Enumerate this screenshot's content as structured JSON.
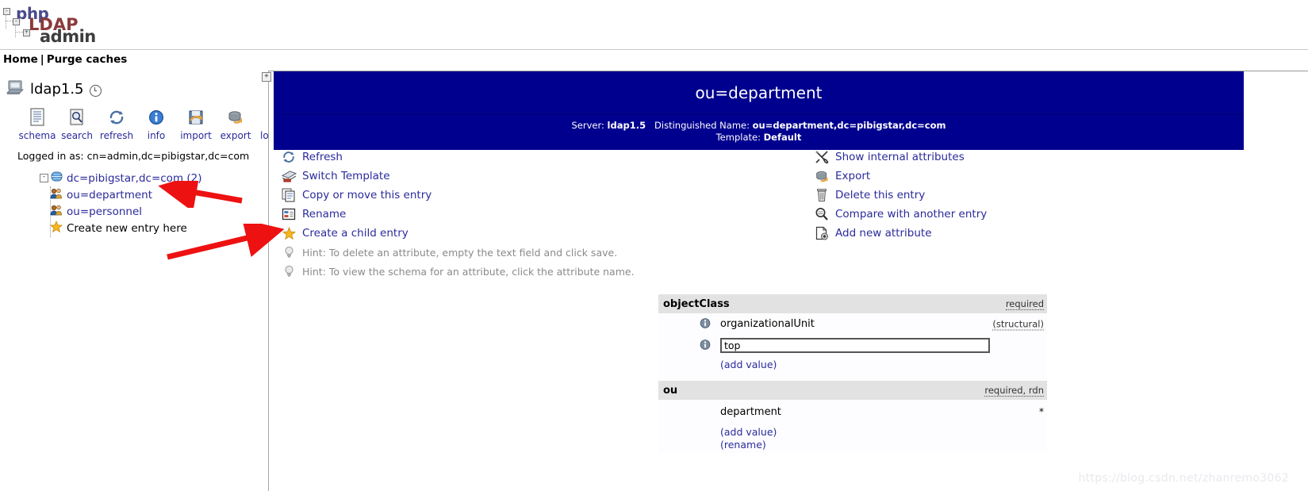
{
  "logo": {
    "php": "php",
    "ldap": "LDAP",
    "admin": "admin"
  },
  "navbar": {
    "home": "Home",
    "separator": "|",
    "purge_caches": "Purge caches"
  },
  "sidebar": {
    "server_name": "ldap1.5",
    "server_icon": "server-computer-icon",
    "clock_icon": "clock-icon",
    "toolbar": [
      {
        "label": "schema",
        "icon": "schema-document-icon"
      },
      {
        "label": "search",
        "icon": "search-magnifier-icon"
      },
      {
        "label": "refresh",
        "icon": "refresh-arrows-icon"
      },
      {
        "label": "info",
        "icon": "info-circle-icon"
      },
      {
        "label": "import",
        "icon": "import-floppy-icon"
      },
      {
        "label": "export",
        "icon": "export-disk-icon"
      },
      {
        "label": "logout",
        "icon": "logout-door-icon"
      }
    ],
    "logged_in_as": "Logged in as: cn=admin,dc=pibigstar,dc=com",
    "tree": {
      "root": {
        "label": "dc=pibigstar,dc=com (2)",
        "icon": "globe-icon",
        "expander": "-"
      },
      "children": [
        {
          "label": "ou=department",
          "icon": "ou-people-icon",
          "type": "entry"
        },
        {
          "label": "ou=personnel",
          "icon": "ou-people-icon",
          "type": "entry"
        },
        {
          "label": "Create new entry here",
          "icon": "star-icon",
          "type": "create"
        }
      ]
    }
  },
  "scroll_button": "+",
  "entry": {
    "title": "ou=department",
    "server_label": "Server:",
    "server_value": "ldap1.5",
    "dn_label": "Distinguished Name:",
    "dn_value": "ou=department,dc=pibigstar,dc=com",
    "template_label": "Template:",
    "template_value": "Default"
  },
  "actions_left": [
    {
      "label": "Refresh",
      "icon": "refresh-arrows-icon",
      "kind": "link"
    },
    {
      "label": "Switch Template",
      "icon": "switch-template-icon",
      "kind": "link"
    },
    {
      "label": "Copy or move this entry",
      "icon": "copy-icon",
      "kind": "link"
    },
    {
      "label": "Rename",
      "icon": "rename-icon",
      "kind": "link"
    },
    {
      "label": "Create a child entry",
      "icon": "star-icon",
      "kind": "link"
    },
    {
      "label": "Hint: To delete an attribute, empty the text field and click save.",
      "icon": "lightbulb-icon",
      "kind": "hint"
    },
    {
      "label": "Hint: To view the schema for an attribute, click the attribute name.",
      "icon": "lightbulb-icon",
      "kind": "hint"
    }
  ],
  "actions_right": [
    {
      "label": "Show internal attributes",
      "icon": "tools-icon"
    },
    {
      "label": "Export",
      "icon": "export-disk-icon"
    },
    {
      "label": "Delete this entry",
      "icon": "trash-icon"
    },
    {
      "label": "Compare with another entry",
      "icon": "compare-magnifier-icon"
    },
    {
      "label": "Add new attribute",
      "icon": "add-attribute-icon"
    }
  ],
  "attributes": [
    {
      "name": "objectClass",
      "flags": "required",
      "values": [
        {
          "value": "organizationalUnit",
          "editable": false,
          "right_note": "(structural)",
          "info_icon": "info-circle-icon"
        },
        {
          "value": "top",
          "editable": true,
          "right_note": "",
          "info_icon": "info-circle-icon"
        }
      ],
      "add_value_label": "(add value)",
      "rename_label": ""
    },
    {
      "name": "ou",
      "flags": "required, rdn",
      "values": [
        {
          "value": "department",
          "editable": false,
          "right_note": "*",
          "info_icon": ""
        }
      ],
      "add_value_label": "(add value)",
      "rename_label": "(rename)"
    }
  ],
  "watermark": "https://blog.csdn.net/zhanremo3062",
  "colors": {
    "header_blue": "#00008f",
    "link_blue": "#2a2a9c",
    "attr_head_grey": "#e2e2e2",
    "hint_grey": "#8a8a8a",
    "arrow_red": "#ee1111"
  }
}
